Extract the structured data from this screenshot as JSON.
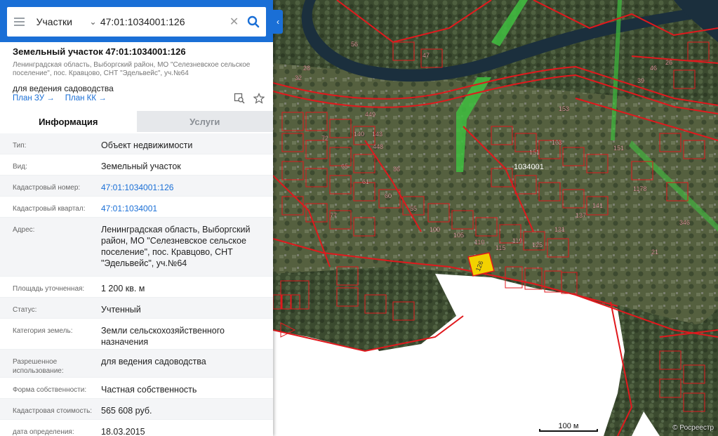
{
  "search": {
    "type_label": "Участки",
    "query": "47:01:1034001:126"
  },
  "parcel": {
    "title": "Земельный участок 47:01:1034001:126",
    "address_small": "Ленинградская область, Выборгский район, МО \"Селезневское сельское поселение\", пос. Кравцово, СНТ \"Эдельвейс\", уч.№64",
    "purpose": "для ведения садоводства",
    "link_plan_zu": "План ЗУ",
    "link_plan_kk": "План КК"
  },
  "tabs": [
    "Информация",
    "Услуги"
  ],
  "rows": [
    {
      "label": "Тип:",
      "value": "Объект недвижимости"
    },
    {
      "label": "Вид:",
      "value": "Земельный участок"
    },
    {
      "label": "Кадастровый номер:",
      "value": "47:01:1034001:126"
    },
    {
      "label": "Кадастровый квартал:",
      "value": "47:01:1034001"
    },
    {
      "label": "Адрес:",
      "value": "Ленинградская область, Выборгский район, МО \"Селезневское сельское поселение\", пос. Кравцово, СНТ \"Эдельвейс\", уч.№64"
    },
    {
      "label": "Площадь уточненная:",
      "value": "1 200 кв. м"
    },
    {
      "label": "Статус:",
      "value": "Учтенный"
    },
    {
      "label": "Категория земель:",
      "value": "Земли сельскохозяйственного назначения"
    },
    {
      "label": "Разрешенное использование:",
      "value": "для ведения садоводства"
    },
    {
      "label": "Форма собственности:",
      "value": "Частная собственность"
    },
    {
      "label": "Кадастровая стоимость:",
      "value": "565 608 руб."
    },
    {
      "label": "дата определения:",
      "value": "18.03.2015"
    }
  ],
  "map": {
    "quarter_label": "1034001",
    "selected_label": "126",
    "scale_label": "100 м",
    "copyright": "© Росреестр",
    "plot_numbers": [
      "56",
      "47",
      "449",
      "143",
      "140",
      "448",
      "153",
      "32",
      "28",
      "72",
      "65",
      "61",
      "60",
      "55",
      "100",
      "105",
      "110",
      "115",
      "119",
      "125",
      "131",
      "137",
      "141",
      "151",
      "39",
      "46",
      "26",
      "21",
      "346",
      "1178",
      "163",
      "151",
      "36",
      "77"
    ],
    "colors": {
      "accent": "#1a6fd6",
      "boundary": "#e0191d",
      "selected": "#f2d200",
      "green": "#3fbf3f"
    }
  }
}
